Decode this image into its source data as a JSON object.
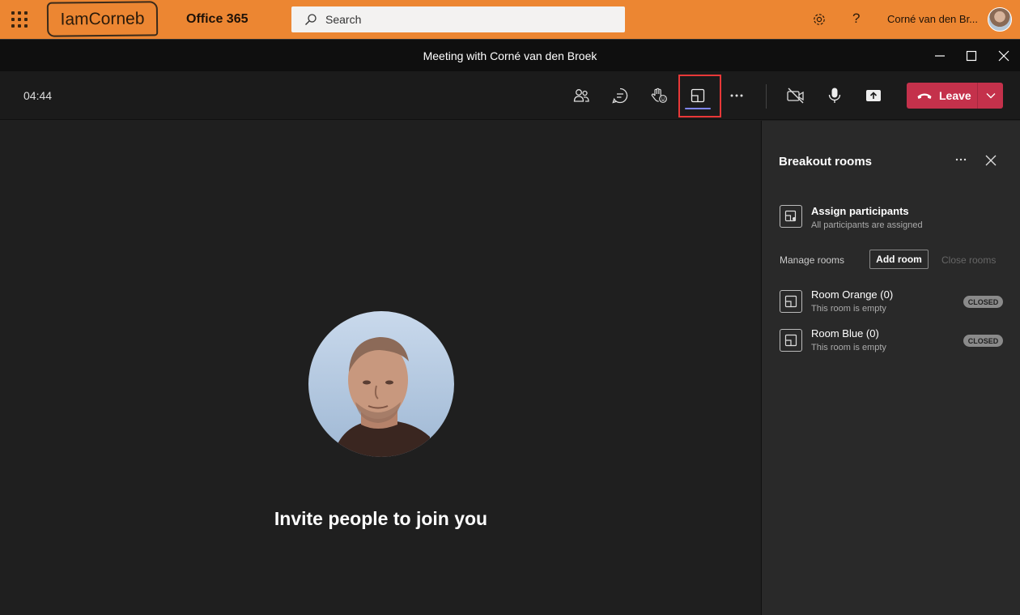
{
  "o365": {
    "logo_text": "IamCorneb",
    "suite_name": "Office 365",
    "search_placeholder": "Search",
    "user_name": "Corné van den Br..."
  },
  "meeting": {
    "title": "Meeting with Corné van den Broek",
    "timer": "04:44",
    "leave_label": "Leave"
  },
  "stage": {
    "invite_text": "Invite people to join you"
  },
  "panel": {
    "title": "Breakout rooms",
    "assign_title": "Assign participants",
    "assign_subtitle": "All participants are assigned",
    "manage_label": "Manage rooms",
    "add_room_label": "Add room",
    "close_rooms_label": "Close rooms",
    "rooms": [
      {
        "name": "Room Orange (0)",
        "status": "This room is empty",
        "badge": "CLOSED"
      },
      {
        "name": "Room Blue (0)",
        "status": "This room is empty",
        "badge": "CLOSED"
      }
    ]
  },
  "colors": {
    "office_bar": "#ec8632",
    "leave_button": "#c4314b",
    "highlight": "#e83838",
    "active_underline": "#7f85f5"
  },
  "icons": [
    "app-launcher-icon",
    "search-icon",
    "settings-icon",
    "help-icon",
    "minimize-icon",
    "maximize-icon",
    "close-icon",
    "participants-icon",
    "chat-icon",
    "reactions-icon",
    "breakout-rooms-icon",
    "more-icon",
    "camera-off-icon",
    "mic-icon",
    "share-icon",
    "hang-up-icon",
    "chevron-down-icon"
  ]
}
